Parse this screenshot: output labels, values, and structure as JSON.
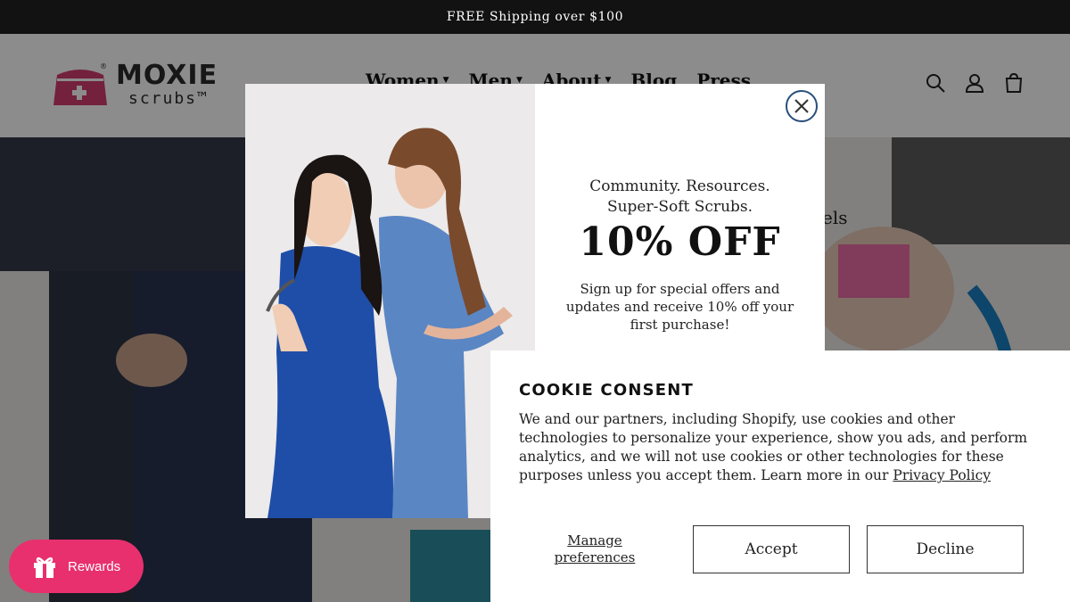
{
  "announcement": "FREE Shipping over $100",
  "brand": {
    "name": "MOXIE",
    "sub": "scrubs™",
    "reg": "®",
    "color": "#d23c6e"
  },
  "nav": [
    {
      "label": "Women"
    },
    {
      "label": "Men"
    },
    {
      "label": "About"
    },
    {
      "label": "Blog"
    },
    {
      "label": "Press"
    }
  ],
  "header_icons": [
    "search-icon",
    "account-icon",
    "cart-icon"
  ],
  "hero": {
    "partial_text": "els"
  },
  "popup": {
    "tagline_1": "Community. Resources.",
    "tagline_2": "Super-Soft Scrubs.",
    "offer": "10% OFF",
    "copy": "Sign up for special offers and updates and receive 10% off your first purchase!"
  },
  "cookie": {
    "title": "COOKIE CONSENT",
    "body": "We and our partners, including Shopify, use cookies and other technologies to personalize your experience, show you ads, and perform analytics, and we will not use cookies or other technologies for these purposes unless you accept them. Learn more in our",
    "link": "Privacy Policy",
    "manage": "Manage preferences",
    "accept": "Accept",
    "decline": "Decline"
  },
  "rewards": {
    "label": "Rewards",
    "color": "#e8306e"
  }
}
